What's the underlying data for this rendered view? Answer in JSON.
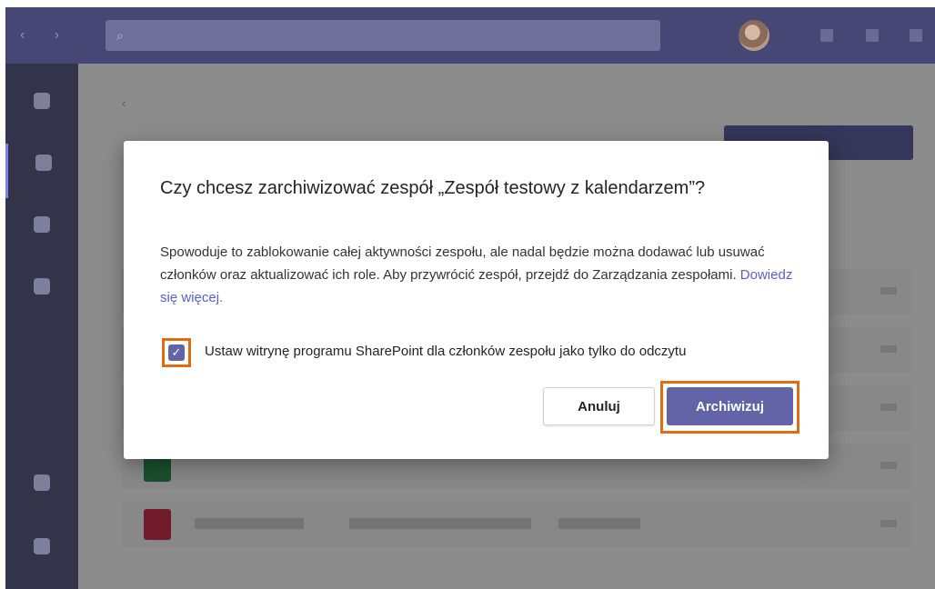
{
  "dialog": {
    "title": "Czy chcesz zarchiwizować zespół „Zespół testowy z kalendarzem”?",
    "body": "Spowoduje to zablokowanie całej aktywności zespołu, ale nadal będzie można dodawać lub usuwać członków oraz aktualizować ich role. Aby przywrócić zespół, przejdź do Zarządzania zespołami.",
    "link": "Dowiedz się więcej.",
    "checkbox": {
      "label": "Ustaw witrynę programu SharePoint dla członków zespołu jako tylko do odczytu",
      "checked": true,
      "checkmark": "✓"
    },
    "cancel_label": "Anuluj",
    "archive_label": "Archiwizuj"
  },
  "colors": {
    "accent": "#6264a7",
    "highlight": "#e06b12",
    "titlebar": "#464775",
    "rail": "#33344a"
  },
  "icons": [
    "search-icon",
    "avatar",
    "activity-icon",
    "teams-icon",
    "calendar-icon",
    "files-icon",
    "apps-icon",
    "help-icon",
    "more-icon"
  ]
}
